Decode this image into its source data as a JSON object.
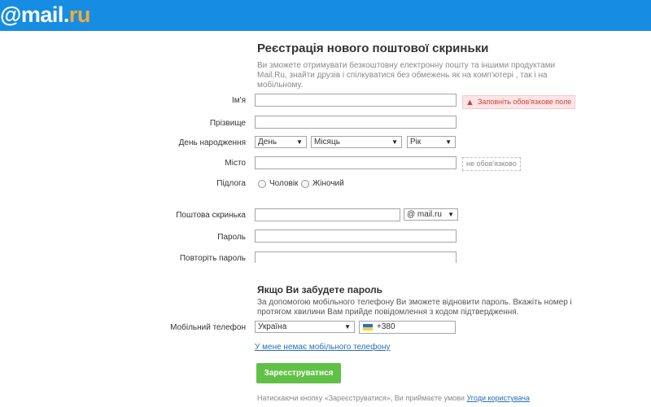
{
  "header": {
    "logo_at": "@",
    "logo_mail": "mail",
    "logo_dot": ".",
    "logo_ru": "ru",
    "bg_color": "#168de2"
  },
  "form": {
    "title": "Реєстрація нового поштової скриньки",
    "subtitle": "Ви зможете отримувати безкоштовну електронну пошту та іншими продуктами Mail.Ru, знайти друзів і спілкуватися без обмежень як на комп'ютері , так і на мобільному.",
    "first_name_label": "Ім'я",
    "first_name_value": "",
    "required_error": "Заповніть обов'язкове поле",
    "last_name_label": "Прізвище",
    "last_name_value": "",
    "birthday_label": "День народження",
    "day_select": "День",
    "month_select": "Місяць",
    "year_select": "Рік",
    "city_label": "Місто",
    "city_value": "",
    "optional_hint": "не обов'язково",
    "gender_label": "Підлога",
    "gender_male": "Чоловік",
    "gender_female": "Жіночий",
    "mailbox_label": "Поштова скринька",
    "mailbox_value": "",
    "domain_select": "@ mail.ru",
    "password_label": "Пароль",
    "password_value": "",
    "repeat_password_label": "Повторіть пароль",
    "repeat_password_value": ""
  },
  "recovery": {
    "title": "Якщо Ви забудете пароль",
    "description": "За допомогою мобільного телефону Ви зможете відновити пароль. Вкажіть номер і протягом хвилини Вам прийде повідомлення з кодом підтвердження.",
    "phone_label": "Мобільний телефон",
    "country_select": "Україна",
    "phone_code": "+380",
    "no_phone_link": "У мене немає мобільного телефону"
  },
  "actions": {
    "register_button": "Зареєструватися",
    "button_color": "#61c146",
    "terms_text": "Натискаючи кнопку «Зареєструватися», Ви приймаєте умови",
    "terms_link": "Угоди користувача"
  }
}
